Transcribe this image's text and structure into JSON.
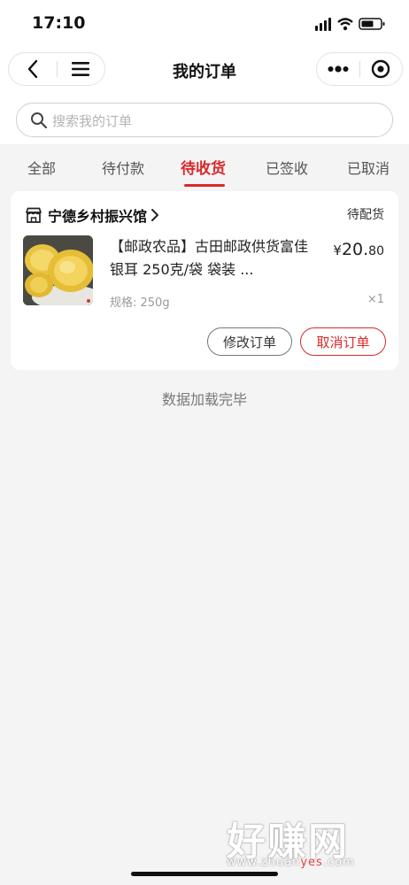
{
  "status_bar": {
    "time": "17:10"
  },
  "nav": {
    "title": "我的订单"
  },
  "search": {
    "placeholder": "搜索我的订单"
  },
  "tabs": [
    {
      "label": "全部",
      "active": false
    },
    {
      "label": "待付款",
      "active": false
    },
    {
      "label": "待收货",
      "active": true
    },
    {
      "label": "已签收",
      "active": false
    },
    {
      "label": "已取消",
      "active": false
    }
  ],
  "order": {
    "store_name": "宁德乡村振兴馆",
    "status": "待配货",
    "product_title": "【邮政农品】古田邮政供货富佳银耳 250克/袋 袋装 ...",
    "price_symbol": "¥",
    "price_int": "20.",
    "price_dec": "80",
    "spec": "规格: 250g",
    "quantity": "×1",
    "modify_label": "修改订单",
    "cancel_label": "取消订单"
  },
  "footer": {
    "loaded_text": "数据加载完毕"
  },
  "watermark": {
    "big": "好赚网",
    "small_pre": "www.zhuan",
    "small_red": "yes",
    "small_post": ".com"
  },
  "colors": {
    "accent": "#d9282a",
    "background": "#f4f4f4"
  }
}
